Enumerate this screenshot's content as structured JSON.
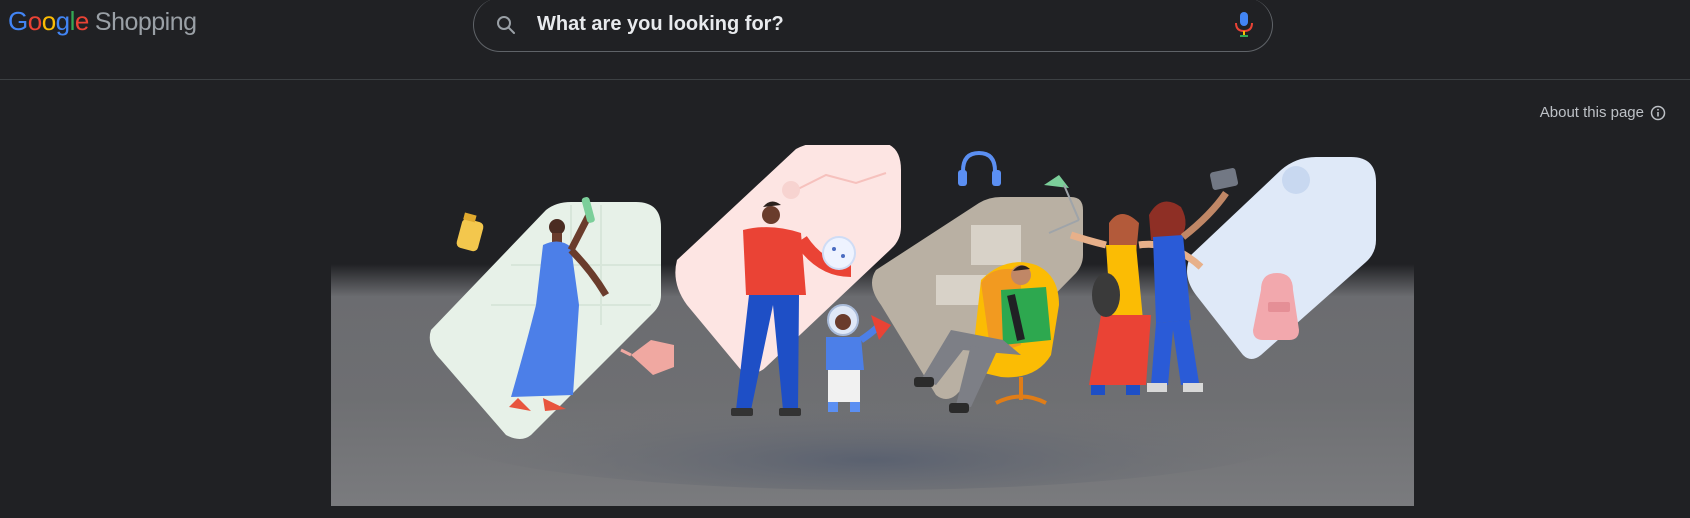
{
  "header": {
    "logo_letters": [
      {
        "char": "G",
        "color": "#4285f4"
      },
      {
        "char": "o",
        "color": "#ea4335"
      },
      {
        "char": "o",
        "color": "#fbbc04"
      },
      {
        "char": "g",
        "color": "#4285f4"
      },
      {
        "char": "l",
        "color": "#34a853"
      },
      {
        "char": "e",
        "color": "#ea4335"
      }
    ],
    "product_name": "Shopping"
  },
  "search": {
    "placeholder": "What are you looking for?",
    "value": "",
    "icon": "search-icon",
    "voice_icon": "mic-icon"
  },
  "about": {
    "label": "About this page",
    "icon": "info-icon"
  },
  "hero": {
    "illustration": "shopping-people-illustration"
  }
}
